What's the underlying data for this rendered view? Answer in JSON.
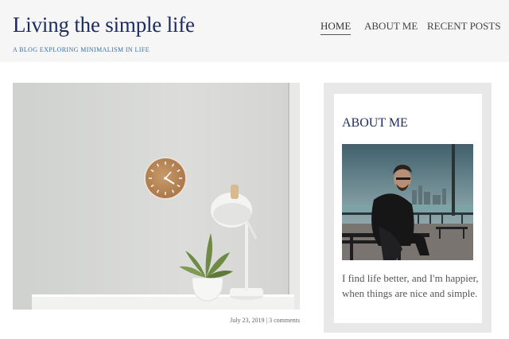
{
  "site": {
    "title": "Living the simple life",
    "tagline": "A BLOG EXPLORING MINIMALISM IN LIFE"
  },
  "nav": {
    "items": [
      {
        "label": "HOME",
        "active": true
      },
      {
        "label": "ABOUT ME",
        "active": false
      },
      {
        "label": "RECENT POSTS",
        "active": false
      }
    ]
  },
  "post": {
    "meta": "July 23, 2019 | 3 comments"
  },
  "sidebar": {
    "about": {
      "title": "ABOUT ME",
      "text": "I find life better, and I'm happier, when things are nice and simple."
    }
  },
  "colors": {
    "title": "#1d2b5e",
    "tagline": "#2f6ea8",
    "header_bg": "#f6f6f6",
    "sidebar_bg": "#e8e8e8"
  }
}
